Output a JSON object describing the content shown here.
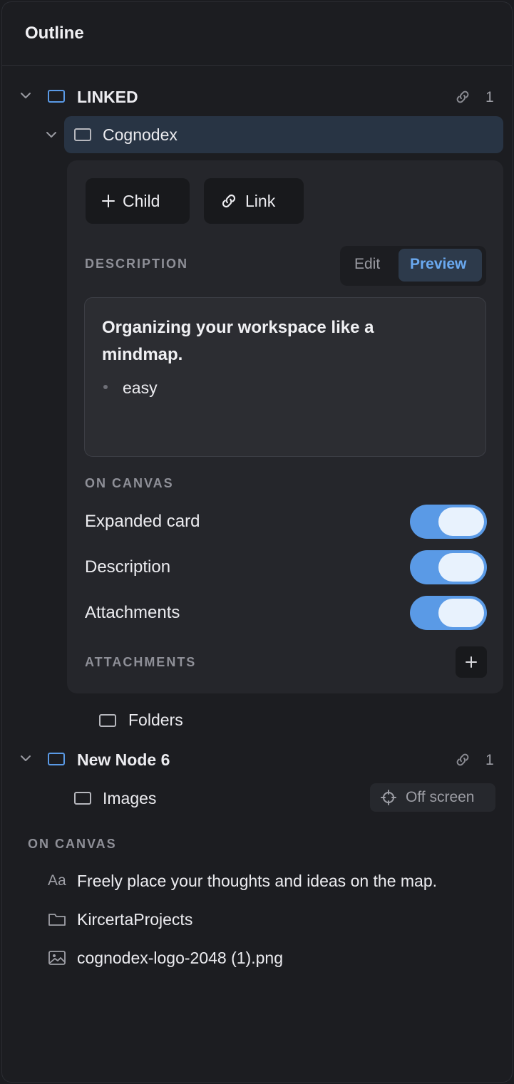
{
  "panel": {
    "title": "Outline"
  },
  "tree": {
    "linked": {
      "label": "LINKED",
      "link_count": "1"
    },
    "cognodex": {
      "label": "Cognodex"
    },
    "card": {
      "child_button": "Child",
      "link_button": "Link",
      "description_label": "DESCRIPTION",
      "tab_edit": "Edit",
      "tab_preview": "Preview",
      "description_heading": "Organizing your workspace like a mindmap.",
      "description_bullets": [
        "easy"
      ],
      "on_canvas_label": "ON CANVAS",
      "toggles": [
        {
          "label": "Expanded card",
          "on": true
        },
        {
          "label": "Description",
          "on": true
        },
        {
          "label": "Attachments",
          "on": true
        }
      ],
      "attachments_label": "ATTACHMENTS"
    },
    "folders": {
      "label": "Folders"
    },
    "new_node": {
      "label": "New Node 6",
      "link_count": "1"
    },
    "images": {
      "label": "Images",
      "status": "Off screen"
    }
  },
  "on_canvas": {
    "label": "ON CANVAS",
    "items": [
      {
        "icon": "text-icon",
        "glyph": "Aa",
        "label": "Freely place your thoughts and ideas on the map."
      },
      {
        "icon": "folder-icon",
        "label": "KircertaProjects"
      },
      {
        "icon": "image-icon",
        "label": "cognodex-logo-2048 (1).png"
      }
    ]
  },
  "colors": {
    "accent": "#5a9ae6",
    "selected_row": "#283444",
    "background": "#1c1d21"
  }
}
